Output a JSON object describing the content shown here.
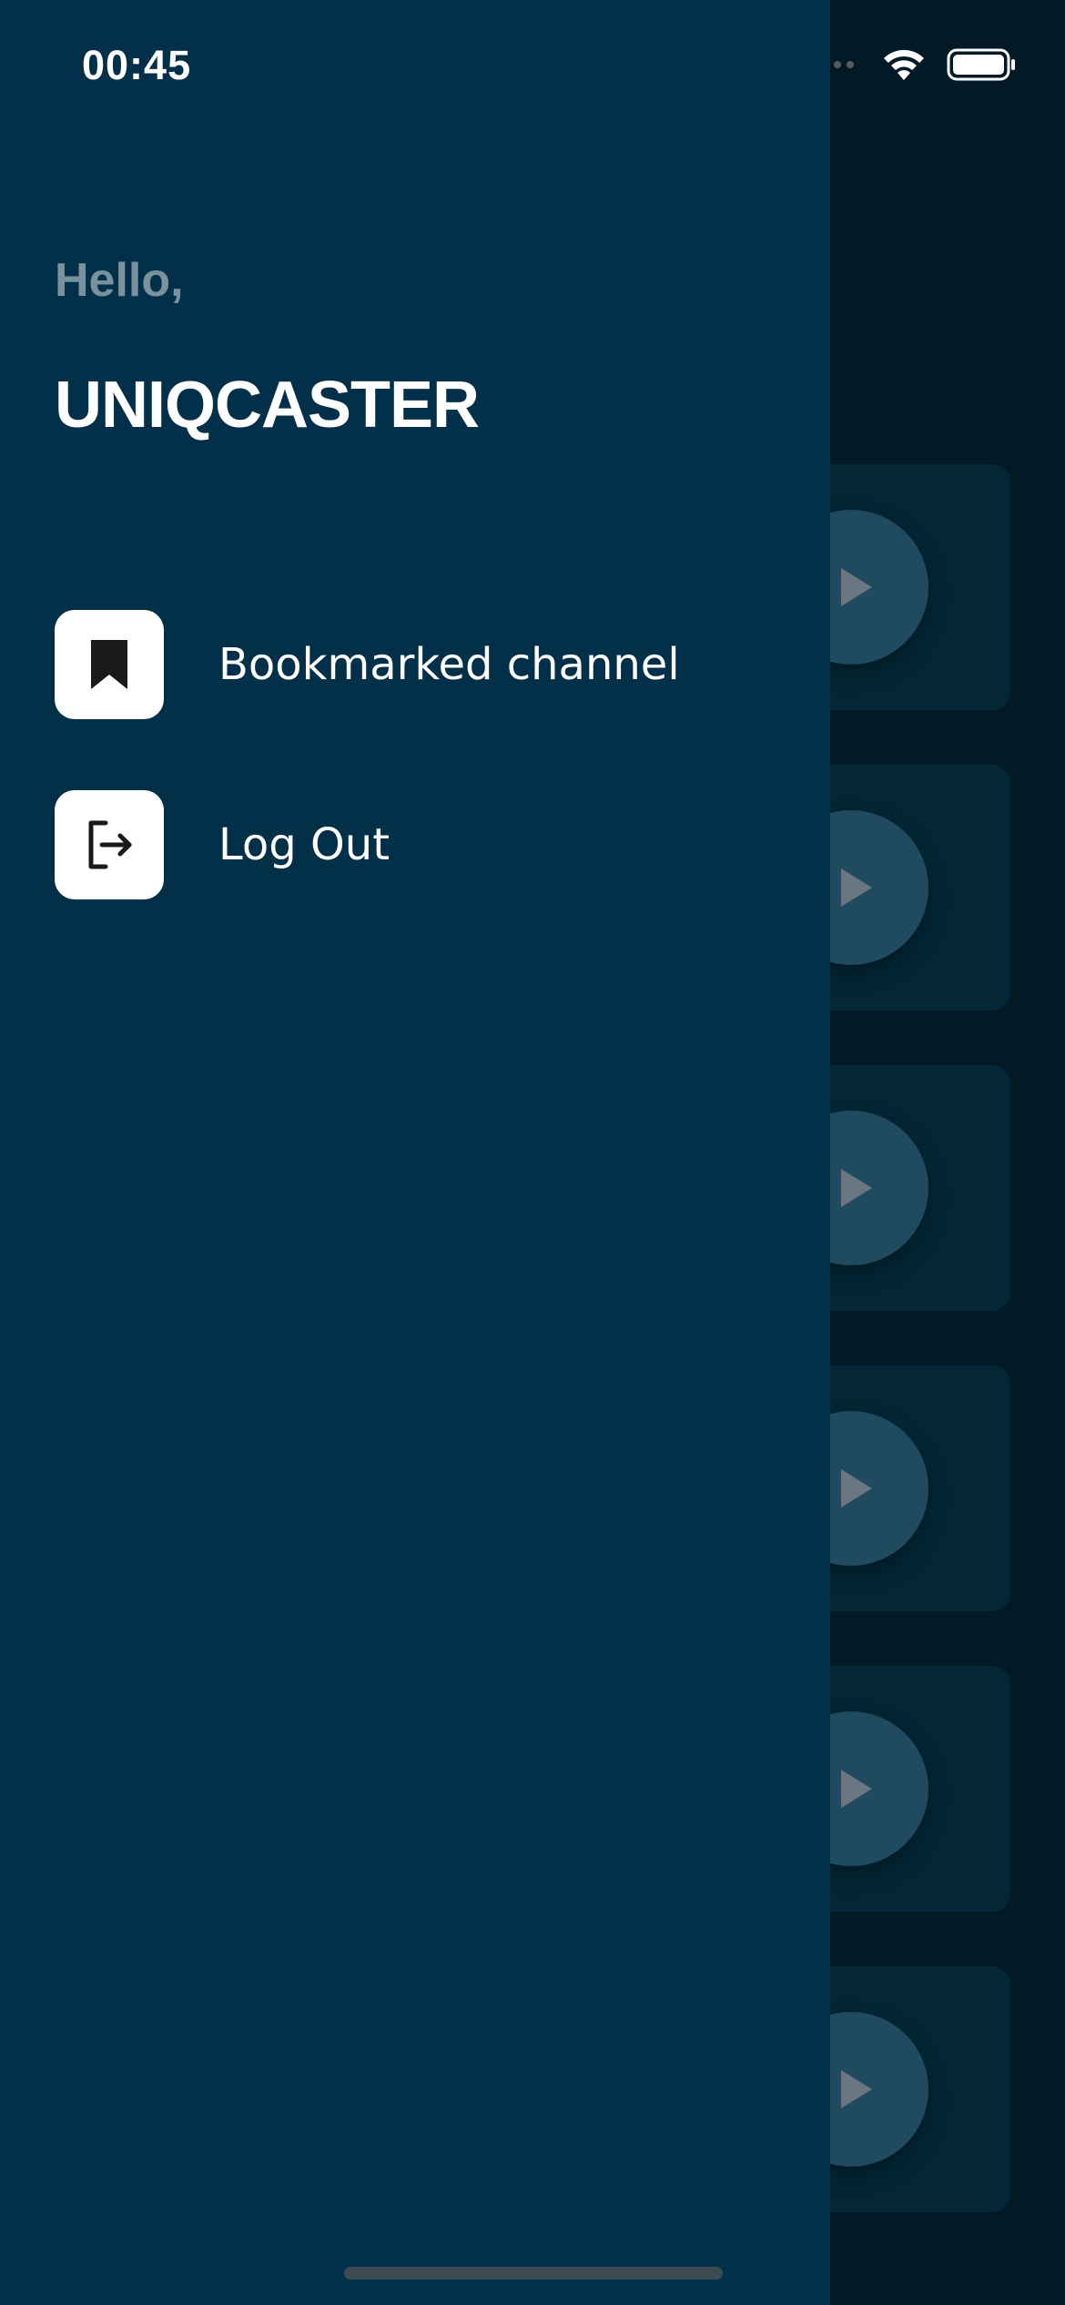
{
  "status_bar": {
    "time": "00:45"
  },
  "drawer": {
    "greeting": "Hello,",
    "username": "UNIQCASTER",
    "menu": [
      {
        "label": "Bookmarked channel",
        "icon": "bookmark-icon"
      },
      {
        "label": "Log Out",
        "icon": "logout-icon"
      }
    ]
  },
  "background_list": {
    "card_count": 6,
    "icon": "play-icon"
  },
  "colors": {
    "drawer_bg": "#02304b",
    "screen_bg": "#021a26",
    "greeting_text": "#7a929e",
    "primary_text": "#ffffff",
    "icon_box_bg": "#ffffff"
  }
}
